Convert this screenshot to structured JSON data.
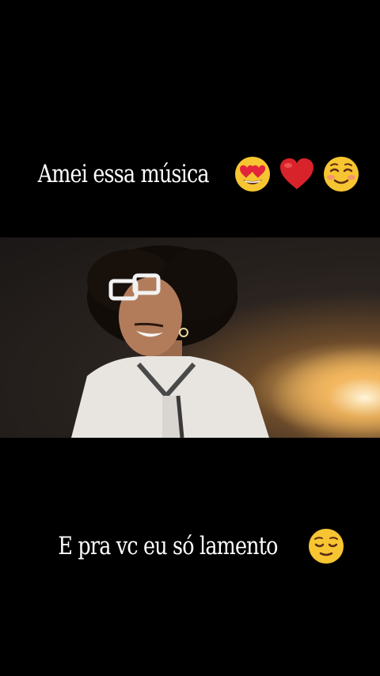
{
  "captions": {
    "top": "Amei essa música",
    "bottom": "E pra vc eu só lamento"
  },
  "icons": {
    "top": [
      "heart-eyes-emoji",
      "red-heart-emoji",
      "smiling-blush-emoji"
    ],
    "bottom": [
      "relieved-face-emoji"
    ]
  },
  "colors": {
    "background": "#000000",
    "text": "#ffffff",
    "emoji_yellow": "#f7c531",
    "heart_red": "#d8232a"
  }
}
